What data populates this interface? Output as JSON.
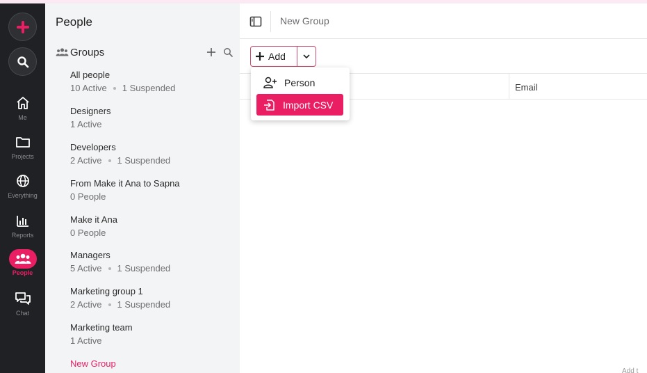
{
  "colors": {
    "accent": "#ea1f63",
    "rail_bg": "#202124",
    "panel_bg": "#f3f4f6"
  },
  "rail": {
    "create_icon": "plus-icon",
    "search_icon": "search-icon",
    "items": [
      {
        "label": "Me",
        "icon": "home-icon"
      },
      {
        "label": "Projects",
        "icon": "folder-icon"
      },
      {
        "label": "Everything",
        "icon": "globe-icon"
      },
      {
        "label": "Reports",
        "icon": "bar-chart-icon"
      },
      {
        "label": "People",
        "icon": "people-icon",
        "active": true
      },
      {
        "label": "Chat",
        "icon": "chat-icon"
      }
    ]
  },
  "panel": {
    "title": "People",
    "groups_label": "Groups",
    "groups": [
      {
        "name": "All people",
        "active": "10 Active",
        "suspended": "1 Suspended"
      },
      {
        "name": "Designers",
        "active": "1 Active"
      },
      {
        "name": "Developers",
        "active": "2 Active",
        "suspended": "1 Suspended"
      },
      {
        "name": "From Make it Ana to Sapna",
        "active": "0 People"
      },
      {
        "name": "Make it Ana",
        "active": "0 People"
      },
      {
        "name": "Managers",
        "active": "5 Active",
        "suspended": "1 Suspended"
      },
      {
        "name": "Marketing group 1",
        "active": "2 Active",
        "suspended": "1 Suspended"
      },
      {
        "name": "Marketing team",
        "active": "1 Active"
      },
      {
        "name": "New Group",
        "selected": true
      }
    ]
  },
  "main": {
    "breadcrumb": "New Group",
    "add_label": "Add",
    "columns": {
      "email": "Email"
    },
    "bottom_hint": "Add t"
  },
  "dropdown": {
    "items": [
      {
        "label": "Person",
        "icon": "person-add-icon"
      },
      {
        "label": "Import CSV",
        "icon": "import-file-icon",
        "highlighted": true
      }
    ]
  }
}
